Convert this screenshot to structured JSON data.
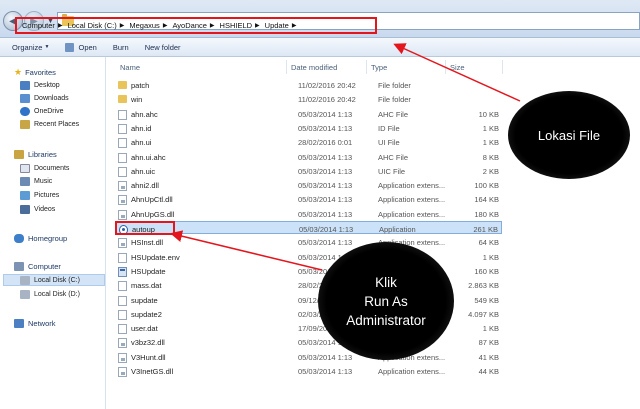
{
  "breadcrumbs": [
    "Computer",
    "Local Disk (C:)",
    "Megaxus",
    "AyoDance",
    "HSHIELD",
    "Update"
  ],
  "toolbar": {
    "organize": "Organize",
    "open": "Open",
    "burn": "Burn",
    "new_folder": "New folder"
  },
  "nav": {
    "favorites": "Favorites",
    "favorites_items": [
      "Desktop",
      "Downloads",
      "OneDrive",
      "Recent Places"
    ],
    "libraries": "Libraries",
    "libraries_items": [
      "Documents",
      "Music",
      "Pictures",
      "Videos"
    ],
    "homegroup": "Homegroup",
    "computer": "Computer",
    "computer_items": [
      "Local Disk (C:)",
      "Local Disk (D:)"
    ],
    "network": "Network"
  },
  "columns": {
    "name": "Name",
    "date": "Date modified",
    "type": "Type",
    "size": "Size"
  },
  "files": [
    {
      "name": "patch",
      "date": "11/02/2016 20:42",
      "type": "File folder",
      "size": "",
      "icon": "folder-icon"
    },
    {
      "name": "win",
      "date": "11/02/2016 20:42",
      "type": "File folder",
      "size": "",
      "icon": "folder-icon"
    },
    {
      "name": "ahn.ahc",
      "date": "05/03/2014 1:13",
      "type": "AHC File",
      "size": "10 KB",
      "icon": "file-icon"
    },
    {
      "name": "ahn.id",
      "date": "05/03/2014 1:13",
      "type": "ID File",
      "size": "1 KB",
      "icon": "file-icon"
    },
    {
      "name": "ahn.ui",
      "date": "28/02/2016 0:01",
      "type": "UI File",
      "size": "1 KB",
      "icon": "file-icon"
    },
    {
      "name": "ahn.ui.ahc",
      "date": "05/03/2014 1:13",
      "type": "AHC File",
      "size": "8 KB",
      "icon": "file-icon"
    },
    {
      "name": "ahn.uic",
      "date": "05/03/2014 1:13",
      "type": "UIC File",
      "size": "2 KB",
      "icon": "file-icon"
    },
    {
      "name": "ahni2.dll",
      "date": "05/03/2014 1:13",
      "type": "Application extens...",
      "size": "100 KB",
      "icon": "dll-icon"
    },
    {
      "name": "AhnUpCtl.dll",
      "date": "05/03/2014 1:13",
      "type": "Application extens...",
      "size": "164 KB",
      "icon": "dll-icon"
    },
    {
      "name": "AhnUpGS.dll",
      "date": "05/03/2014 1:13",
      "type": "Application extens...",
      "size": "180 KB",
      "icon": "dll-icon"
    },
    {
      "name": "autoup",
      "date": "05/03/2014 1:13",
      "type": "Application",
      "size": "261 KB",
      "icon": "autoup-icon"
    },
    {
      "name": "HSInst.dll",
      "date": "05/03/2014 1:13",
      "type": "Application extens...",
      "size": "64 KB",
      "icon": "dll-icon"
    },
    {
      "name": "HSUpdate.env",
      "date": "05/03/2014 1:13",
      "type": "",
      "size": "1 KB",
      "icon": "file-icon"
    },
    {
      "name": "HSUpdate",
      "date": "05/03/2014 1:13",
      "type": "",
      "size": "160 KB",
      "icon": "app-icon"
    },
    {
      "name": "mass.dat",
      "date": "28/02/20",
      "type": "",
      "size": "2.863 KB",
      "icon": "file-icon"
    },
    {
      "name": "supdate",
      "date": "09/12/",
      "type": "",
      "size": "549 KB",
      "icon": "file-icon"
    },
    {
      "name": "supdate2",
      "date": "02/03/2",
      "type": "",
      "size": "4.097 KB",
      "icon": "file-icon"
    },
    {
      "name": "user.dat",
      "date": "17/09/20",
      "type": "",
      "size": "1 KB",
      "icon": "file-icon"
    },
    {
      "name": "v3bz32.dll",
      "date": "05/03/2014 1:13",
      "type": "",
      "size": "87 KB",
      "icon": "dll-icon"
    },
    {
      "name": "V3Hunt.dll",
      "date": "05/03/2014 1:13",
      "type": "Application extens...",
      "size": "41 KB",
      "icon": "dll-icon"
    },
    {
      "name": "V3InetGS.dll",
      "date": "05/03/2014 1:13",
      "type": "Application extens...",
      "size": "44 KB",
      "icon": "dll-icon"
    }
  ],
  "annotations": {
    "lokasi": "Lokasi File",
    "klik_lines": [
      "Klik",
      "Run As",
      "Administrator"
    ]
  },
  "colors": {
    "annotation_red": "#e4161d",
    "selection": "#cce2f8"
  }
}
